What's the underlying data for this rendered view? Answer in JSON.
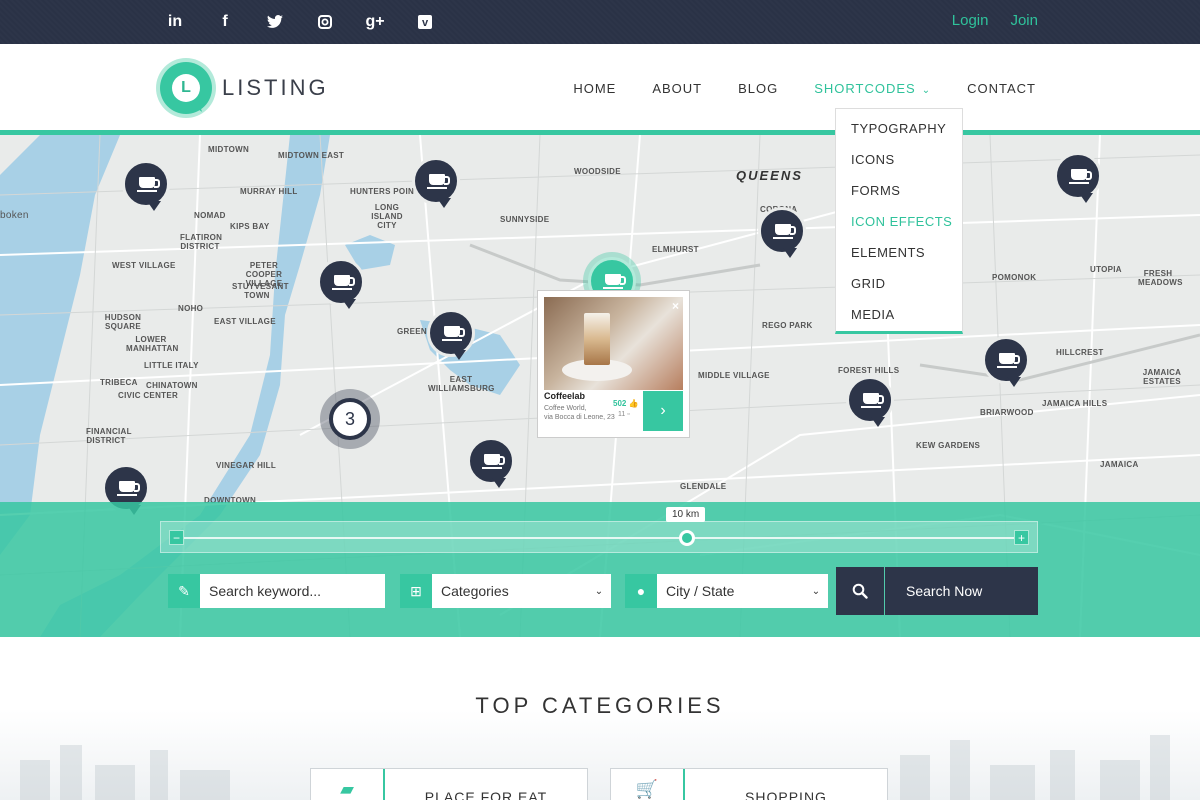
{
  "topbar": {
    "social": [
      {
        "icon": "linkedin-icon",
        "glyph": "in"
      },
      {
        "icon": "facebook-icon",
        "glyph": "f"
      },
      {
        "icon": "twitter-icon",
        "glyph": "t"
      },
      {
        "icon": "instagram-icon",
        "glyph": "◙"
      },
      {
        "icon": "google-plus-icon",
        "glyph": "g+"
      },
      {
        "icon": "vimeo-icon",
        "glyph": "v"
      }
    ],
    "login": "Login",
    "join": "Join"
  },
  "header": {
    "logo_letter": "L",
    "logo_text": "LISTING",
    "nav": [
      {
        "label": "HOME"
      },
      {
        "label": "ABOUT"
      },
      {
        "label": "BLOG"
      },
      {
        "label": "SHORTCODES",
        "active": true
      },
      {
        "label": "CONTACT"
      }
    ]
  },
  "dropdown": {
    "items": [
      "TYPOGRAPHY",
      "ICONS",
      "FORMS",
      "ICON EFFECTS",
      "ELEMENTS",
      "GRID",
      "MEDIA"
    ],
    "active_index": 3
  },
  "map": {
    "labels": {
      "queens": "QUEENS",
      "midtown": "MIDTOWN",
      "midtown_east": "MIDTOWN EAST",
      "murray_hill": "MURRAY HILL",
      "nomad": "NOMAD",
      "kips_bay": "KIPS BAY",
      "flatiron": "FLATIRON DISTRICT",
      "west_village": "WEST VILLAGE",
      "peter_cooper": "PETER COOPER VILLAGE",
      "stuyvesant": "STUYVESANT TOWN",
      "noho": "NOHO",
      "east_village": "EAST VILLAGE",
      "hudson_square": "HUDSON SQUARE",
      "lower_manhattan": "LOWER MANHATTAN",
      "little_italy": "LITTLE ITALY",
      "tribeca": "TRIBECA",
      "chinatown": "CHINATOWN",
      "civic_center": "CIVIC CENTER",
      "financial": "FINANCIAL DISTRICT",
      "vinegar_hill": "VINEGAR HILL",
      "downtown": "DOWNTOWN",
      "hunters_point": "HUNTERS POINT",
      "long_island_city": "LONG ISLAND CITY",
      "sunnyside": "SUNNYSIDE",
      "woodside": "WOODSIDE",
      "elmhurst": "ELMHURST",
      "corona": "CORONA",
      "greenpoint": "GREENPO",
      "east_williamsburg": "EAST WILLIAMSBURG",
      "rego_park": "REGO PARK",
      "middle_village": "MIDDLE VILLAGE",
      "forest_hills": "FOREST HILLS",
      "kew_gardens": "KEW GARDENS",
      "glendale": "GLENDALE",
      "pomonok": "POMONOK",
      "utopia": "UTOPIA",
      "fresh_meadows": "FRESH MEADOWS",
      "hillcrest": "HILLCREST",
      "jamaica_estates": "JAMAICA ESTATES",
      "briarwood": "BRIARWOOD",
      "jamaica_hills": "JAMAICA HILLS",
      "jamaica": "JAMAICA",
      "boken": "boken"
    },
    "cluster_count": "3",
    "popup": {
      "name": "Coffeelab",
      "address_line1": "Coffee World,",
      "address_line2": "via Bocca di Leone, 23",
      "likes": "502",
      "comments": "11",
      "close_glyph": "×",
      "go_glyph": "›"
    }
  },
  "search": {
    "range_value": "10 km",
    "minus": "−",
    "plus": "+",
    "keyword_placeholder": "Search keyword...",
    "categories": "Categories",
    "city": "City / State",
    "search_button": "Search Now"
  },
  "categories": {
    "title": "TOP  CATEGORIES",
    "cards": [
      {
        "label": "PLACE FOR EAT",
        "icon": "restaurant-icon"
      },
      {
        "label": "SHOPPING",
        "icon": "shopping-cart-icon"
      }
    ]
  },
  "colors": {
    "accent": "#37c7a1",
    "dark": "#2d3549",
    "map_bg": "#e9ebea",
    "water": "#a8d0e6"
  }
}
